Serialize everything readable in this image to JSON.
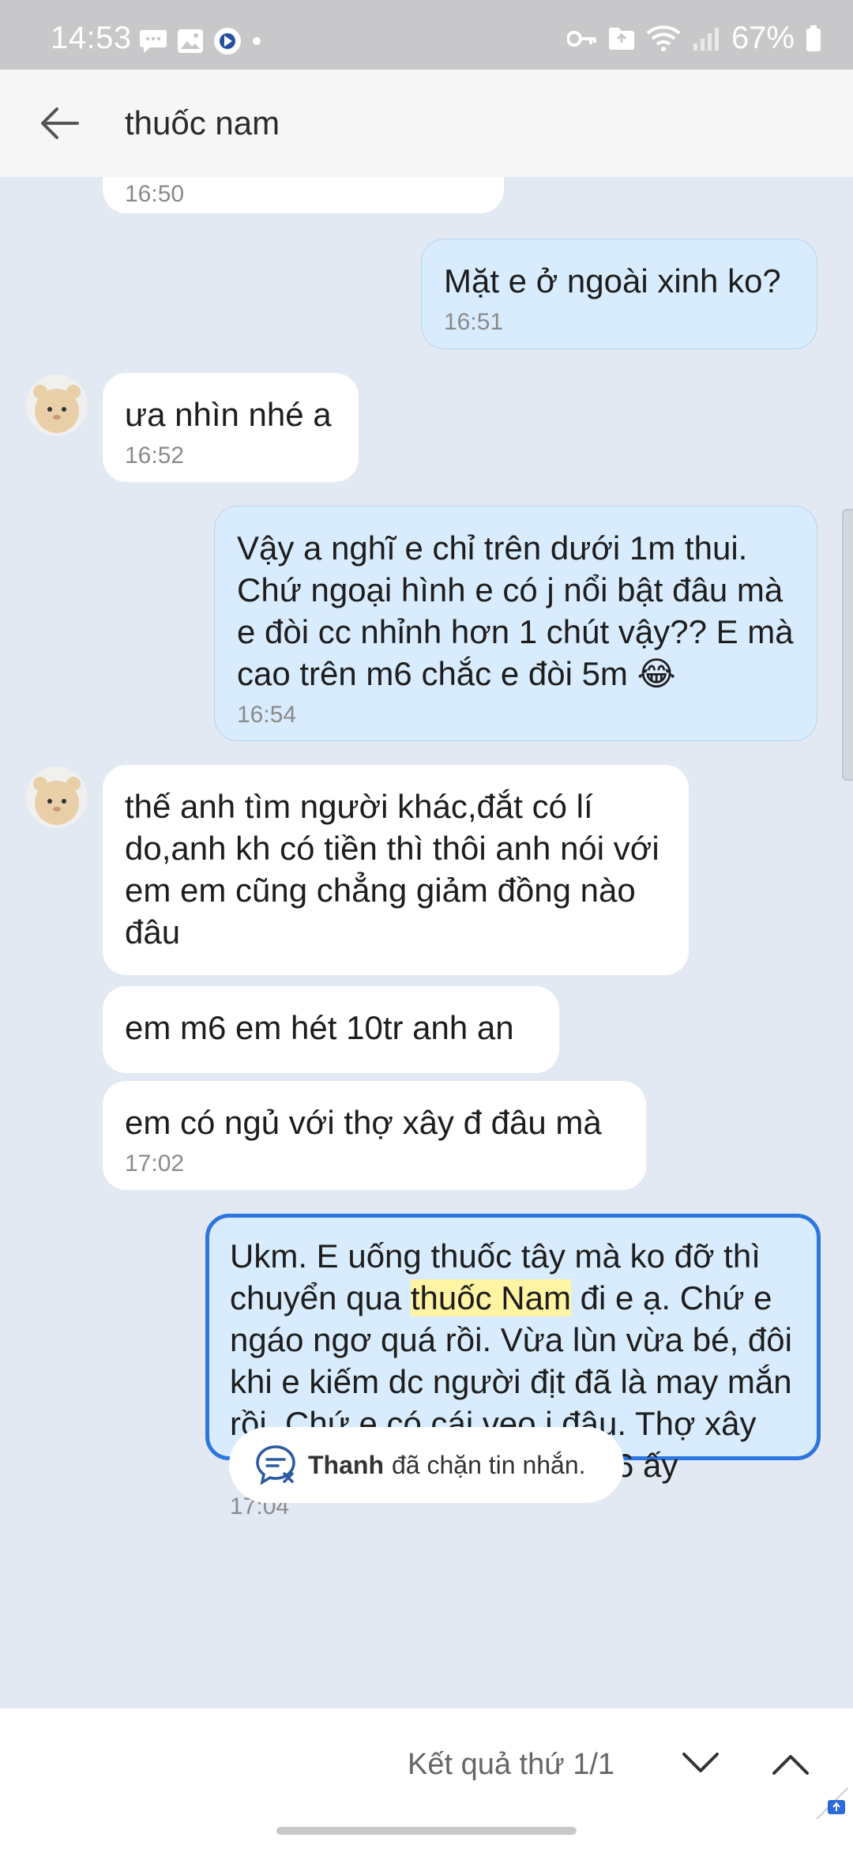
{
  "status_bar": {
    "time": "14:53",
    "battery": "67%",
    "left_icons": [
      "chat-bubble-icon",
      "gallery-icon",
      "app-circle-icon",
      "dot-icon"
    ],
    "right_icons": [
      "key-icon",
      "folder-icon",
      "wifi-icon",
      "signal-icon",
      "battery-icon"
    ]
  },
  "header": {
    "back_icon": "arrow-left-icon",
    "title": "thuốc nam"
  },
  "messages": [
    {
      "dir": "in",
      "text": "",
      "time": "16:50"
    },
    {
      "dir": "out",
      "text": "Mặt e ở ngoài xinh ko?",
      "time": "16:51"
    },
    {
      "dir": "in",
      "text": "ưa nhìn nhé a",
      "time": "16:52"
    },
    {
      "dir": "out",
      "text": "Vậy a nghĩ e chỉ trên dưới 1m thui. Chứ ngoại hình e có j nổi bật đâu mà e đòi cc nhỉnh hơn 1 chút vậy?? E mà cao trên m6 chắc e đòi 5m",
      "emoji": "😂",
      "time": "16:54"
    },
    {
      "dir": "in",
      "text": "thế anh tìm người khác,đắt có lí do,anh kh có tiền thì thôi anh nói với em em cũng chẳng giảm đồng nào đâu",
      "time": ""
    },
    {
      "dir": "in",
      "text": "em m6 em hét 10tr anh an",
      "time": ""
    },
    {
      "dir": "in",
      "text": "em có ngủ với thợ xây đ đâu mà",
      "time": "17:02"
    },
    {
      "dir": "out",
      "text_before": "Ukm. E uống thuốc tây mà ko đỡ thì chuyển qua ",
      "highlight": "thuốc Nam",
      "text_after": " đi e ạ. Chứ e ngáo ngơ quá rồi. Vừa lùn vừa bé, đôi khi e kiếm dc người địt đã là may mắn rồi. Chứ e có cái vẹo j đâu. Thợ xây đôi khi họ cũng yêu cầu m6 ấy",
      "time": "17:04"
    }
  ],
  "notice": {
    "icon": "blocked-chat-icon",
    "name": "Thanh",
    "text": "đã chặn tin nhắn."
  },
  "search_bar": {
    "result_text": "Kết quả thứ 1/1",
    "down_icon": "chevron-down-icon",
    "up_icon": "chevron-up-icon"
  },
  "colors": {
    "background": "#e2e9f2",
    "outgoing_bubble": "#d9ecfd",
    "highlight_border": "#2c76df",
    "search_highlight": "#fff4a3"
  }
}
